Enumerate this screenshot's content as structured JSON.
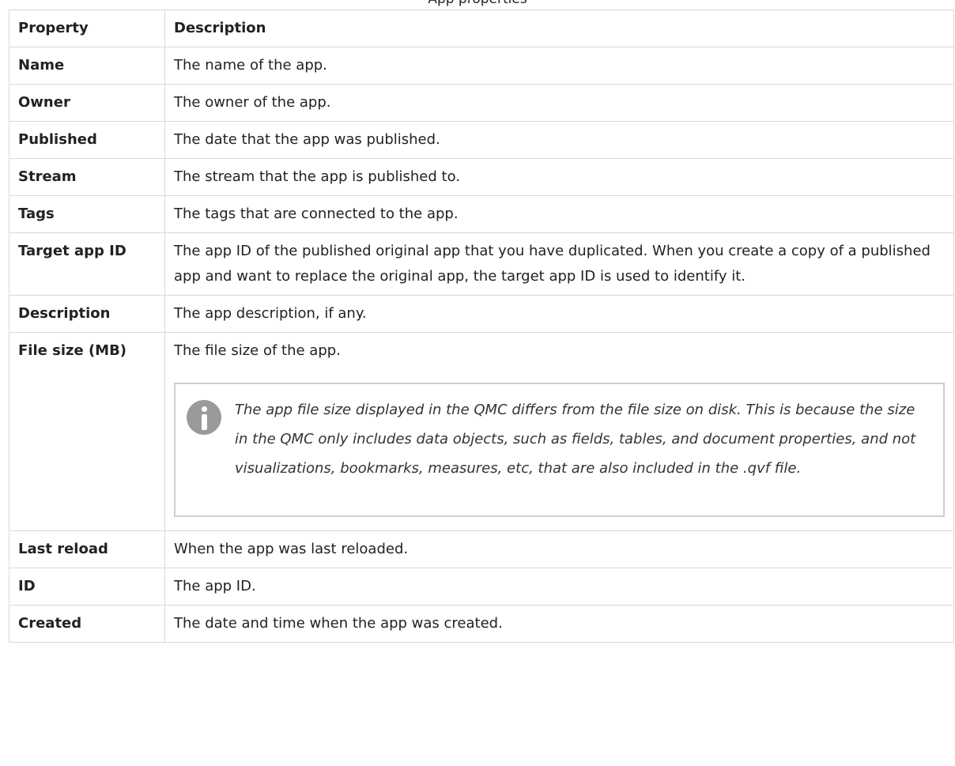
{
  "table": {
    "caption": "App properties",
    "headers": [
      "Property",
      "Description"
    ],
    "rows": [
      {
        "property": "Name",
        "description": "The name of the app."
      },
      {
        "property": "Owner",
        "description": "The owner of the app."
      },
      {
        "property": "Published",
        "description": "The date that the app was published."
      },
      {
        "property": "Stream",
        "description": "The stream that the app is published to."
      },
      {
        "property": "Tags",
        "description": "The tags that are connected to the app."
      },
      {
        "property": "Target app ID",
        "description": "The app ID of the published original app that you have duplicated. When you create a copy of a published app and want to replace the original app, the target app ID is used to identify it."
      },
      {
        "property": "Description",
        "description": "The app description, if any."
      },
      {
        "property": "File size (MB)",
        "description": "The file size of the app.",
        "note": {
          "icon": "info-icon",
          "text": "The app file size displayed in the QMC differs from the file size on disk. This is because the size in the QMC only includes data objects, such as fields, tables, and document properties, and not visualizations, bookmarks, measures, etc, that are also included in the .qvf file."
        }
      },
      {
        "property": "Last reload",
        "description": "When the app was last reloaded."
      },
      {
        "property": "ID",
        "description": "The app ID."
      },
      {
        "property": "Created",
        "description": "The date and time when the app was created."
      }
    ]
  }
}
